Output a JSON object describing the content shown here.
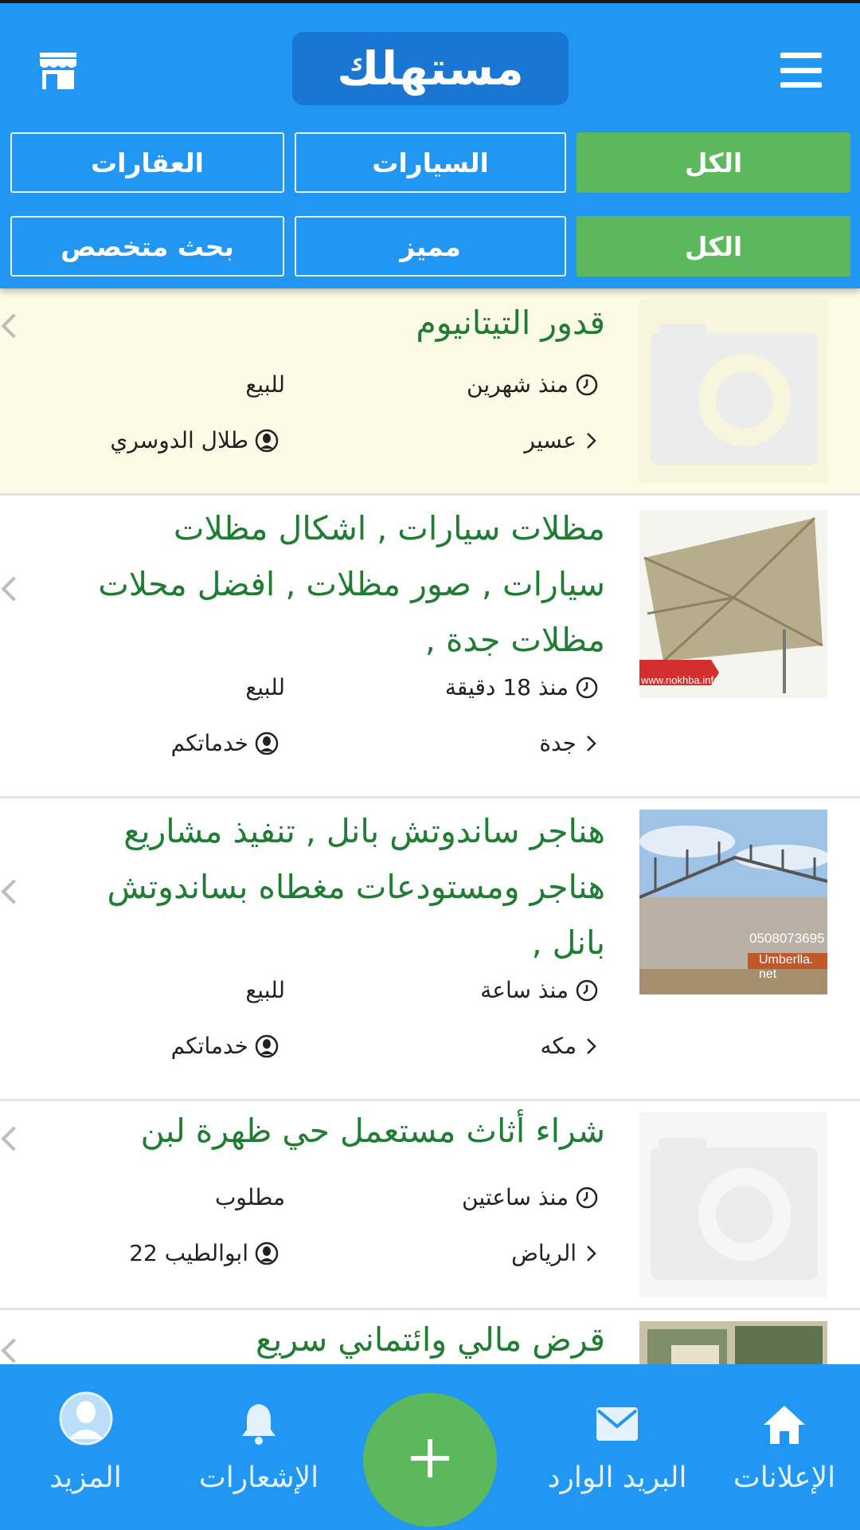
{
  "app": {
    "logo_text": "مستهلك"
  },
  "header": {
    "menu_icon": "hamburger-menu-icon",
    "store_icon": "store-icon",
    "category_filters": [
      "الكل",
      "السيارات",
      "العقارات"
    ],
    "type_filters": [
      "الكل",
      "مميز",
      "بحث متخصص"
    ],
    "colors": {
      "header": "#2196f3",
      "active": "#5cb85c",
      "logo_bg": "#1976d2"
    }
  },
  "listings": [
    {
      "title": "قدور التيتانيوم",
      "time": "منذ شهرين",
      "type": "للبيع",
      "location": "عسير",
      "user": "طلال الدوسري",
      "image": "camera-placeholder-icon"
    },
    {
      "title": "مظلات سيارات , اشكال مظلات سيارات , صور مظلات , افضل محلات مظلات جدة ,",
      "time": "منذ 18 دقيقة",
      "type": "للبيع",
      "location": "جدة",
      "user": "خدماتكم",
      "image": "car-shade-photo",
      "image_caption": "www.nokhba.info"
    },
    {
      "title": "هناجر ساندوتش بانل , تنفيذ مشاريع هناجر ومستودعات مغطاه بساندوتش بانل ,",
      "time": "منذ ساعة",
      "type": "للبيع",
      "location": "مكه",
      "user": "خدماتكم",
      "image": "warehouse-photo",
      "image_phone": "0508073695",
      "image_site": "Umberlla. net"
    },
    {
      "title": "شراء أثاث مستعمل حي ظهرة لبن",
      "time": "منذ ساعتين",
      "type": "مطلوب",
      "location": "الرياض",
      "user": "ابوالطيب 22",
      "image": "camera-placeholder-icon"
    },
    {
      "title": "قرض مالي وائتماني سريع",
      "image": "money-photo"
    }
  ],
  "bottom_nav": [
    {
      "label": "الإعلانات",
      "icon": "home-icon"
    },
    {
      "label": "البريد الوارد",
      "icon": "mail-icon"
    },
    {
      "label": "",
      "icon": "plus-icon"
    },
    {
      "label": "الإشعارات",
      "icon": "bell-icon"
    },
    {
      "label": "المزيد",
      "icon": "user-avatar-icon"
    }
  ]
}
